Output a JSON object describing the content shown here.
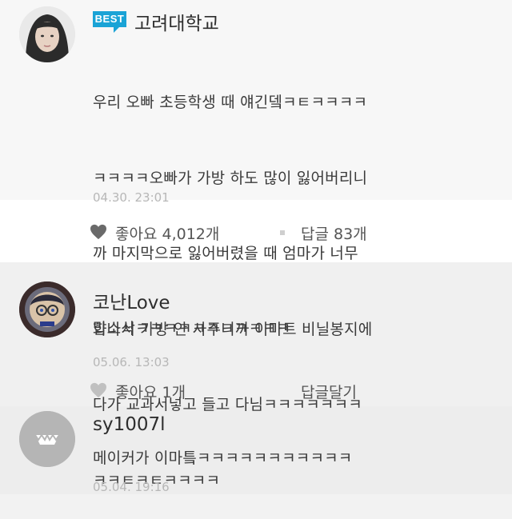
{
  "comments": [
    {
      "badge": "BEST",
      "author": "고려대학교",
      "text_lines": [
        "우리 오빠 초등학생 때 얘긴뎈ㅋㅌㅋㅋㅋㅋ",
        "ㅋㅋㅋㅋ오빠가 가방 하도 많이 잃어버리니",
        "까 마지막으로 잃어버렸을 때 엄마가 너무",
        "화나서 가방 안 사주니까 이마트 비닐봉지에",
        "다가 교과서넣고 들고 다님ㅋㅋㅋㅋㅋㅋㅋ",
        "ㅋㅋㅌㅋㅌㅋㅋㅋㅋ"
      ],
      "timestamp": "04.30. 23:01",
      "like_label": "좋아요 4,012개",
      "reply_label": "답글 83개"
    },
    {
      "author": "코난Love",
      "text": "맙소삭ㅋㅋㅋㅋㅋㅋㅋㅋㅋㅋㅋ",
      "timestamp": "05.06. 13:03",
      "like_label": "좋아요 1개",
      "reply_label": "답글달기"
    },
    {
      "author": "sy1007l",
      "text": "메이커가 이마틐ㅋㅋㅋㅋㅋㅋㅋㅋㅋㅋㅋ",
      "timestamp": "05.04. 19:16"
    }
  ],
  "colors": {
    "best_badge": "#1aa3d6",
    "timestamp": "#b7b7b7"
  },
  "icons": [
    "heart-icon",
    "conan-avatar",
    "smile-teeth-avatar"
  ]
}
